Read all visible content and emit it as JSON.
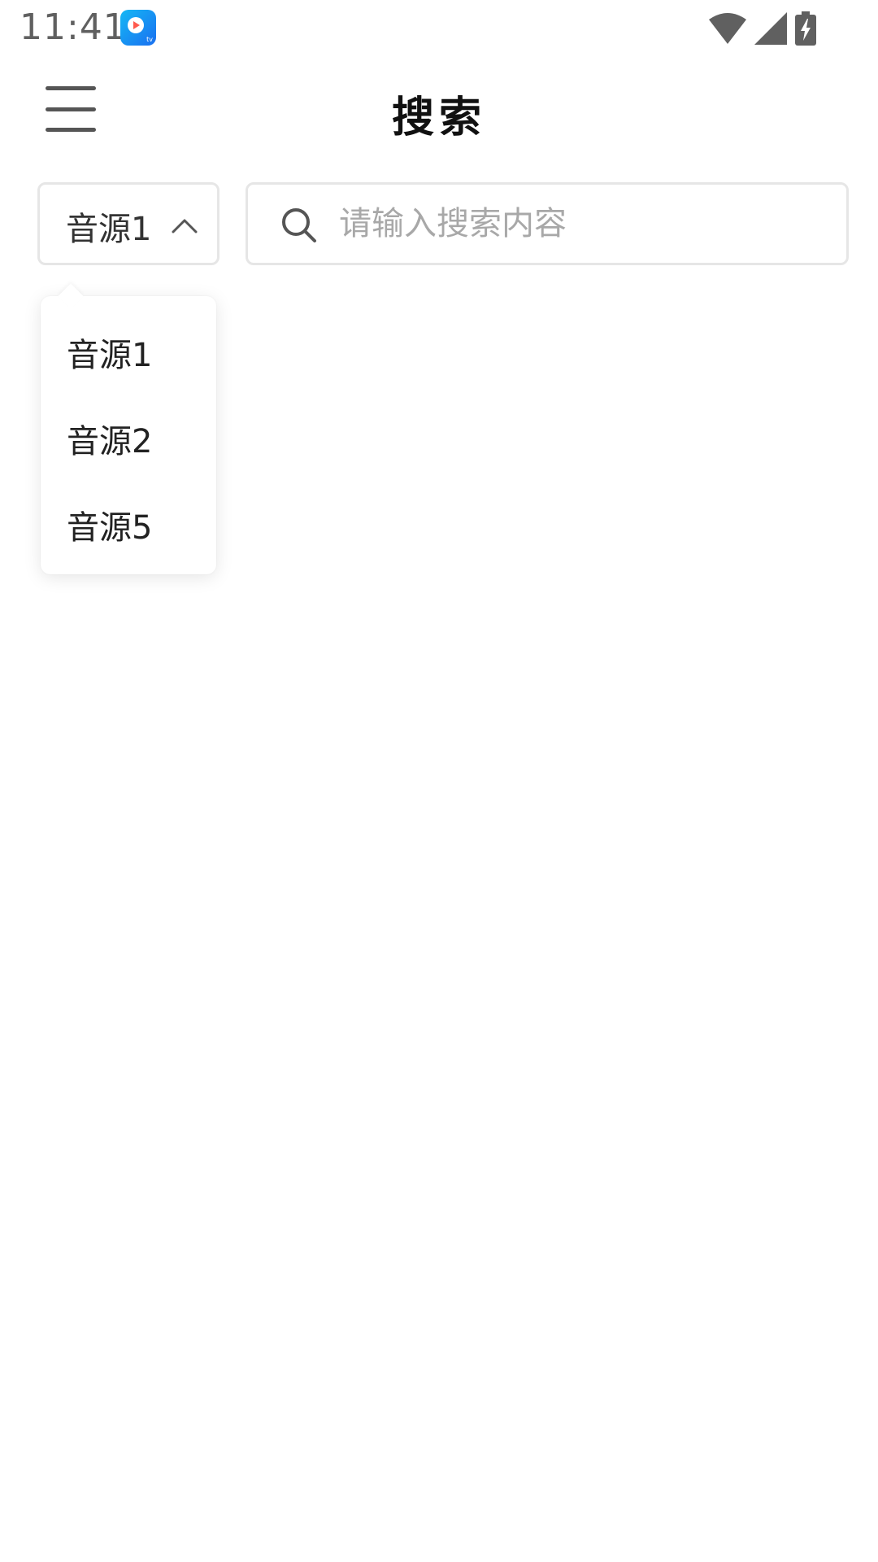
{
  "status_bar": {
    "time": "11:41",
    "icons": [
      "app-badge-icon",
      "wifi-icon",
      "signal-icon",
      "battery-charging-icon"
    ]
  },
  "header": {
    "title": "搜索",
    "menu_icon": "hamburger-menu-icon"
  },
  "source_selector": {
    "selected": "音源1",
    "expanded": true,
    "options": [
      "音源1",
      "音源2",
      "音源5"
    ]
  },
  "search": {
    "placeholder": "请输入搜索内容",
    "value": "",
    "icon": "search-icon"
  },
  "colors": {
    "border": "#e6e6e6",
    "title": "#111111",
    "placeholder": "#a8a8a8",
    "app_badge": "#1a8ff0"
  }
}
